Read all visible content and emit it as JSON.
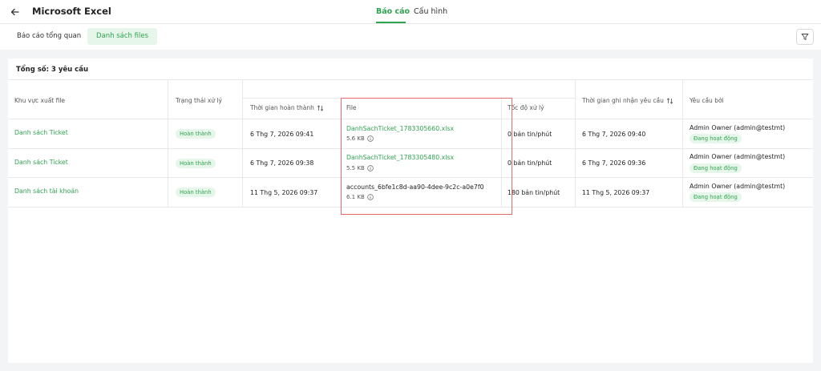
{
  "header": {
    "title": "Microsoft Excel",
    "tabs": [
      {
        "label": "Báo cáo",
        "active": true
      },
      {
        "label": "Cấu hình",
        "active": false
      }
    ]
  },
  "subnav": {
    "tabs": [
      {
        "label": "Báo cáo tổng quan",
        "active": false
      },
      {
        "label": "Danh sách files",
        "active": true
      }
    ]
  },
  "summary": {
    "total": "Tổng số: 3 yêu cầu"
  },
  "table": {
    "columns": {
      "area": "Khu vực xuất file",
      "status": "Trạng thái xử lý",
      "completed_at": "Thời gian hoàn thành",
      "file": "File",
      "speed": "Tốc độ xử lý",
      "received_at": "Thời gian ghi nhận yêu cầu",
      "requested_by": "Yêu cầu bởi"
    },
    "rows": [
      {
        "area": "Danh sách Ticket",
        "status": "Hoàn thành",
        "completed_at": "6 Thg 7, 2026 09:41",
        "file_name": "DanhSachTicket_1783305660.xlsx",
        "file_size": "5.6 KB",
        "speed": "0 bản tin/phút",
        "received_at": "6 Thg 7, 2026 09:40",
        "requester": "Admin Owner (admin@testmt)",
        "requester_status": "Đang hoạt động"
      },
      {
        "area": "Danh sách Ticket",
        "status": "Hoàn thành",
        "completed_at": "6 Thg 7, 2026 09:38",
        "file_name": "DanhSachTicket_1783305480.xlsx",
        "file_size": "5.5 KB",
        "speed": "0 bản tin/phút",
        "received_at": "6 Thg 7, 2026 09:36",
        "requester": "Admin Owner (admin@testmt)",
        "requester_status": "Đang hoạt động"
      },
      {
        "area": "Danh sách tài khoản",
        "status": "Hoàn thành",
        "completed_at": "11 Thg 5, 2026 09:37",
        "file_name": "accounts_6bfe1c8d-aa90-4dee-9c2c-a0e7f0",
        "file_size": "6.1 KB",
        "speed": "180 bản tin/phút",
        "received_at": "11 Thg 5, 2026 09:37",
        "requester": "Admin Owner (admin@testmt)",
        "requester_status": "Đang hoạt động"
      }
    ]
  },
  "colors": {
    "accent": "#2ea44f",
    "accent_bg": "#e7f6ea",
    "highlight": "#e36b6b"
  }
}
